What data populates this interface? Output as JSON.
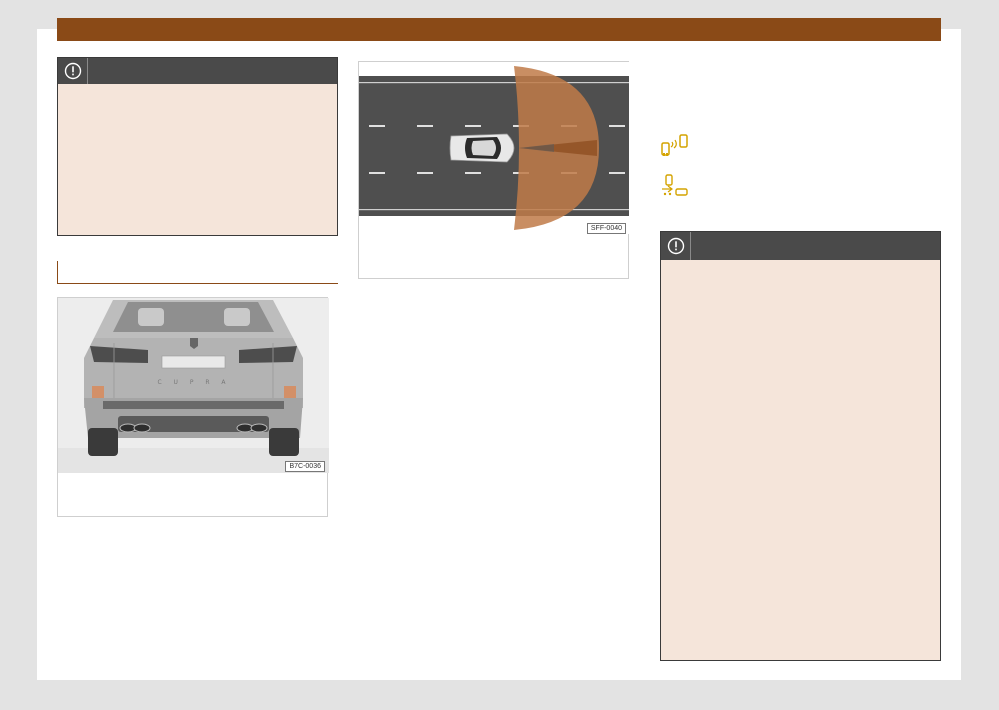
{
  "figures": {
    "rear_code": "B7C-0036",
    "road_code": "SFF-0040"
  },
  "icons": {
    "warning_icon": "exclamation-circle-icon",
    "parking_sensor_icon": "parking-sensor-car-icon",
    "traffic_icon": "traffic-warning-car-icon"
  },
  "colors": {
    "header_bar": "#8a4a17",
    "warning_bg": "#f5e5da",
    "warning_head": "#4a4a4a",
    "sensor_zone": "#c07a48"
  }
}
